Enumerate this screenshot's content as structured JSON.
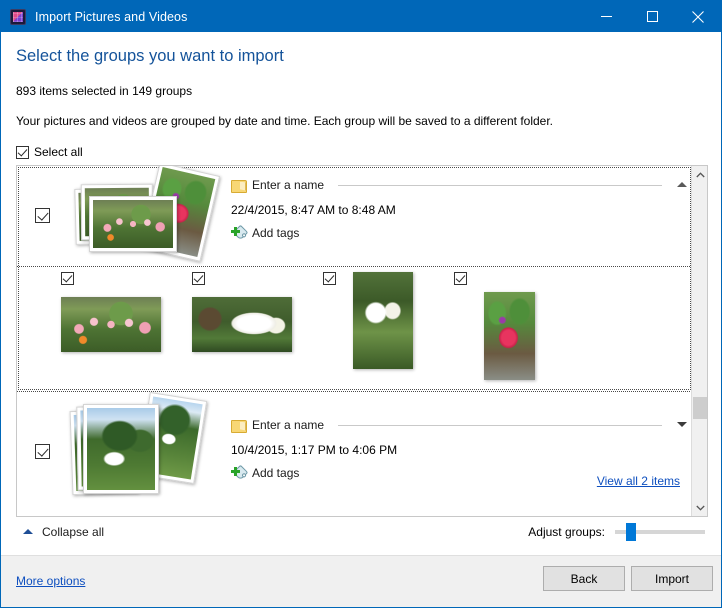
{
  "window": {
    "title": "Import Pictures and Videos",
    "icon": "device-phone-icon",
    "accent_color": "#0067b8",
    "minimize_label": "Minimize",
    "maximize_label": "Maximize",
    "close_label": "Close"
  },
  "header": {
    "title": "Select the groups you want to import",
    "subtitle": "893 items selected in 149 groups",
    "description": "Your pictures and videos are grouped by date and time. Each group will be saved to a different folder.",
    "select_all_label": "Select all",
    "select_all_checked": true
  },
  "groups": [
    {
      "checked": true,
      "name_placeholder": "Enter a name",
      "date_range": "22/4/2015, 8:47 AM to 8:48 AM",
      "add_tags_label": "Add tags",
      "expander": "collapse-chevron-up",
      "expanded": true,
      "view_all_label": "",
      "thumbnails": [
        {
          "checked": true,
          "orientation": "landscape",
          "subject": "pink-flower-field"
        },
        {
          "checked": true,
          "orientation": "landscape",
          "subject": "white-amaryllis"
        },
        {
          "checked": true,
          "orientation": "portrait",
          "subject": "two-white-lilies"
        },
        {
          "checked": true,
          "orientation": "portrait",
          "subject": "red-flower-pot"
        }
      ]
    },
    {
      "checked": true,
      "name_placeholder": "Enter a name",
      "date_range": "10/4/2015, 1:17 PM to 4:06 PM",
      "add_tags_label": "Add tags",
      "expander": "expand-chevron-down",
      "expanded": false,
      "view_all_label": "View all 2 items",
      "thumbnails": []
    }
  ],
  "footer": {
    "collapse_all_label": "Collapse all",
    "adjust_groups_label": "Adjust groups:",
    "slider_value_percent": 14,
    "more_options_label": "More options",
    "back_label": "Back",
    "import_label": "Import"
  },
  "scrollbar": {
    "up_arrow": "scroll-up-arrow",
    "down_arrow": "scroll-down-arrow",
    "thumb_top_percent": 66,
    "thumb_height_percent": 6
  }
}
